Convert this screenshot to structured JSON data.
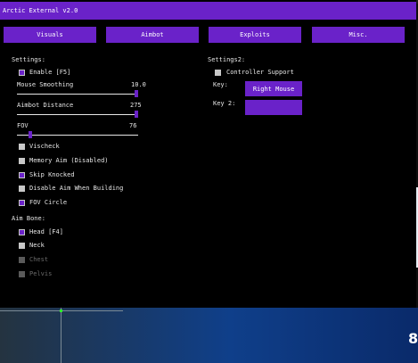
{
  "window": {
    "title": "Arctic External v2.0"
  },
  "tabs": [
    {
      "label": "Visuals"
    },
    {
      "label": "Aimbot"
    },
    {
      "label": "Exploits"
    },
    {
      "label": "Misc."
    }
  ],
  "settings": {
    "heading": "Settings:",
    "enable": {
      "label": "Enable [F5]",
      "checked": true
    },
    "sliders": [
      {
        "label": "Mouse Smoothing",
        "value": "10.0",
        "fraction": 1.0
      },
      {
        "label": "Aimbot Distance",
        "value": "275",
        "fraction": 1.0
      },
      {
        "label": "FOV",
        "value": "76",
        "fraction": 0.1
      }
    ],
    "options": [
      {
        "label": "Vischeck",
        "checked": false
      },
      {
        "label": "Memory Aim (Disabled)",
        "checked": false
      },
      {
        "label": "Skip Knocked",
        "checked": true
      },
      {
        "label": "Disable Aim When Building",
        "checked": false
      },
      {
        "label": "FOV Circle",
        "checked": true
      }
    ],
    "aim_bone": {
      "heading": "Aim Bone:",
      "options": [
        {
          "label": "Head [F4]",
          "checked": true,
          "disabled": false
        },
        {
          "label": "Neck",
          "checked": false,
          "disabled": false
        },
        {
          "label": "Chest",
          "checked": false,
          "disabled": true
        },
        {
          "label": "Pelvis",
          "checked": false,
          "disabled": true
        }
      ]
    }
  },
  "settings2": {
    "heading": "Settings2:",
    "controller": {
      "label": "Controller Support",
      "checked": false
    },
    "key": {
      "label": "Key:",
      "value": "Right Mouse"
    },
    "key2": {
      "label": "Key 2:",
      "value": ""
    }
  },
  "background": {
    "corner_number": "8"
  },
  "colors": {
    "accent": "#6a22c9",
    "panel": "#000000"
  }
}
